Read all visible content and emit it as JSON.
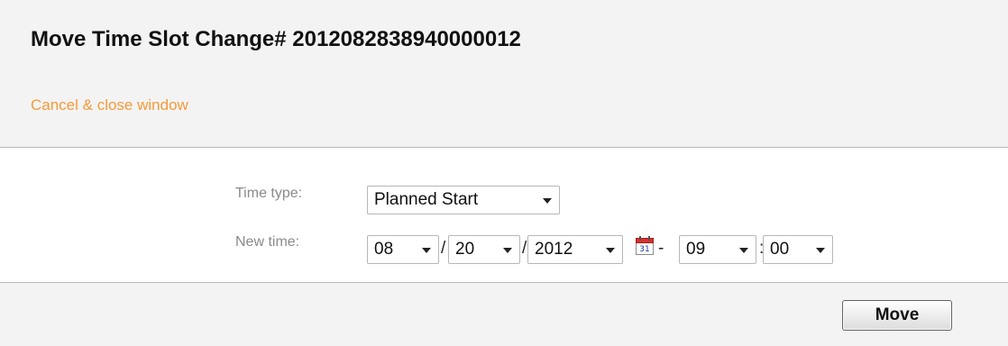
{
  "header": {
    "title": "Move Time Slot Change# 2012082838940000012",
    "cancel_link": "Cancel & close window"
  },
  "form": {
    "time_type_label": "Time type:",
    "time_type_value": "Planned Start",
    "new_time_label": "New time:",
    "month": "08",
    "day": "20",
    "year": "2012",
    "hour": "09",
    "minute": "00",
    "date_separator": "/",
    "time_dash": "-",
    "time_colon": ":",
    "calendar_day": "31"
  },
  "footer": {
    "move_label": "Move"
  },
  "colors": {
    "link": "#f49a3b",
    "header_bg": "#f3f3f3",
    "label": "#8a8a8a",
    "calendar_red": "#d9302c"
  }
}
